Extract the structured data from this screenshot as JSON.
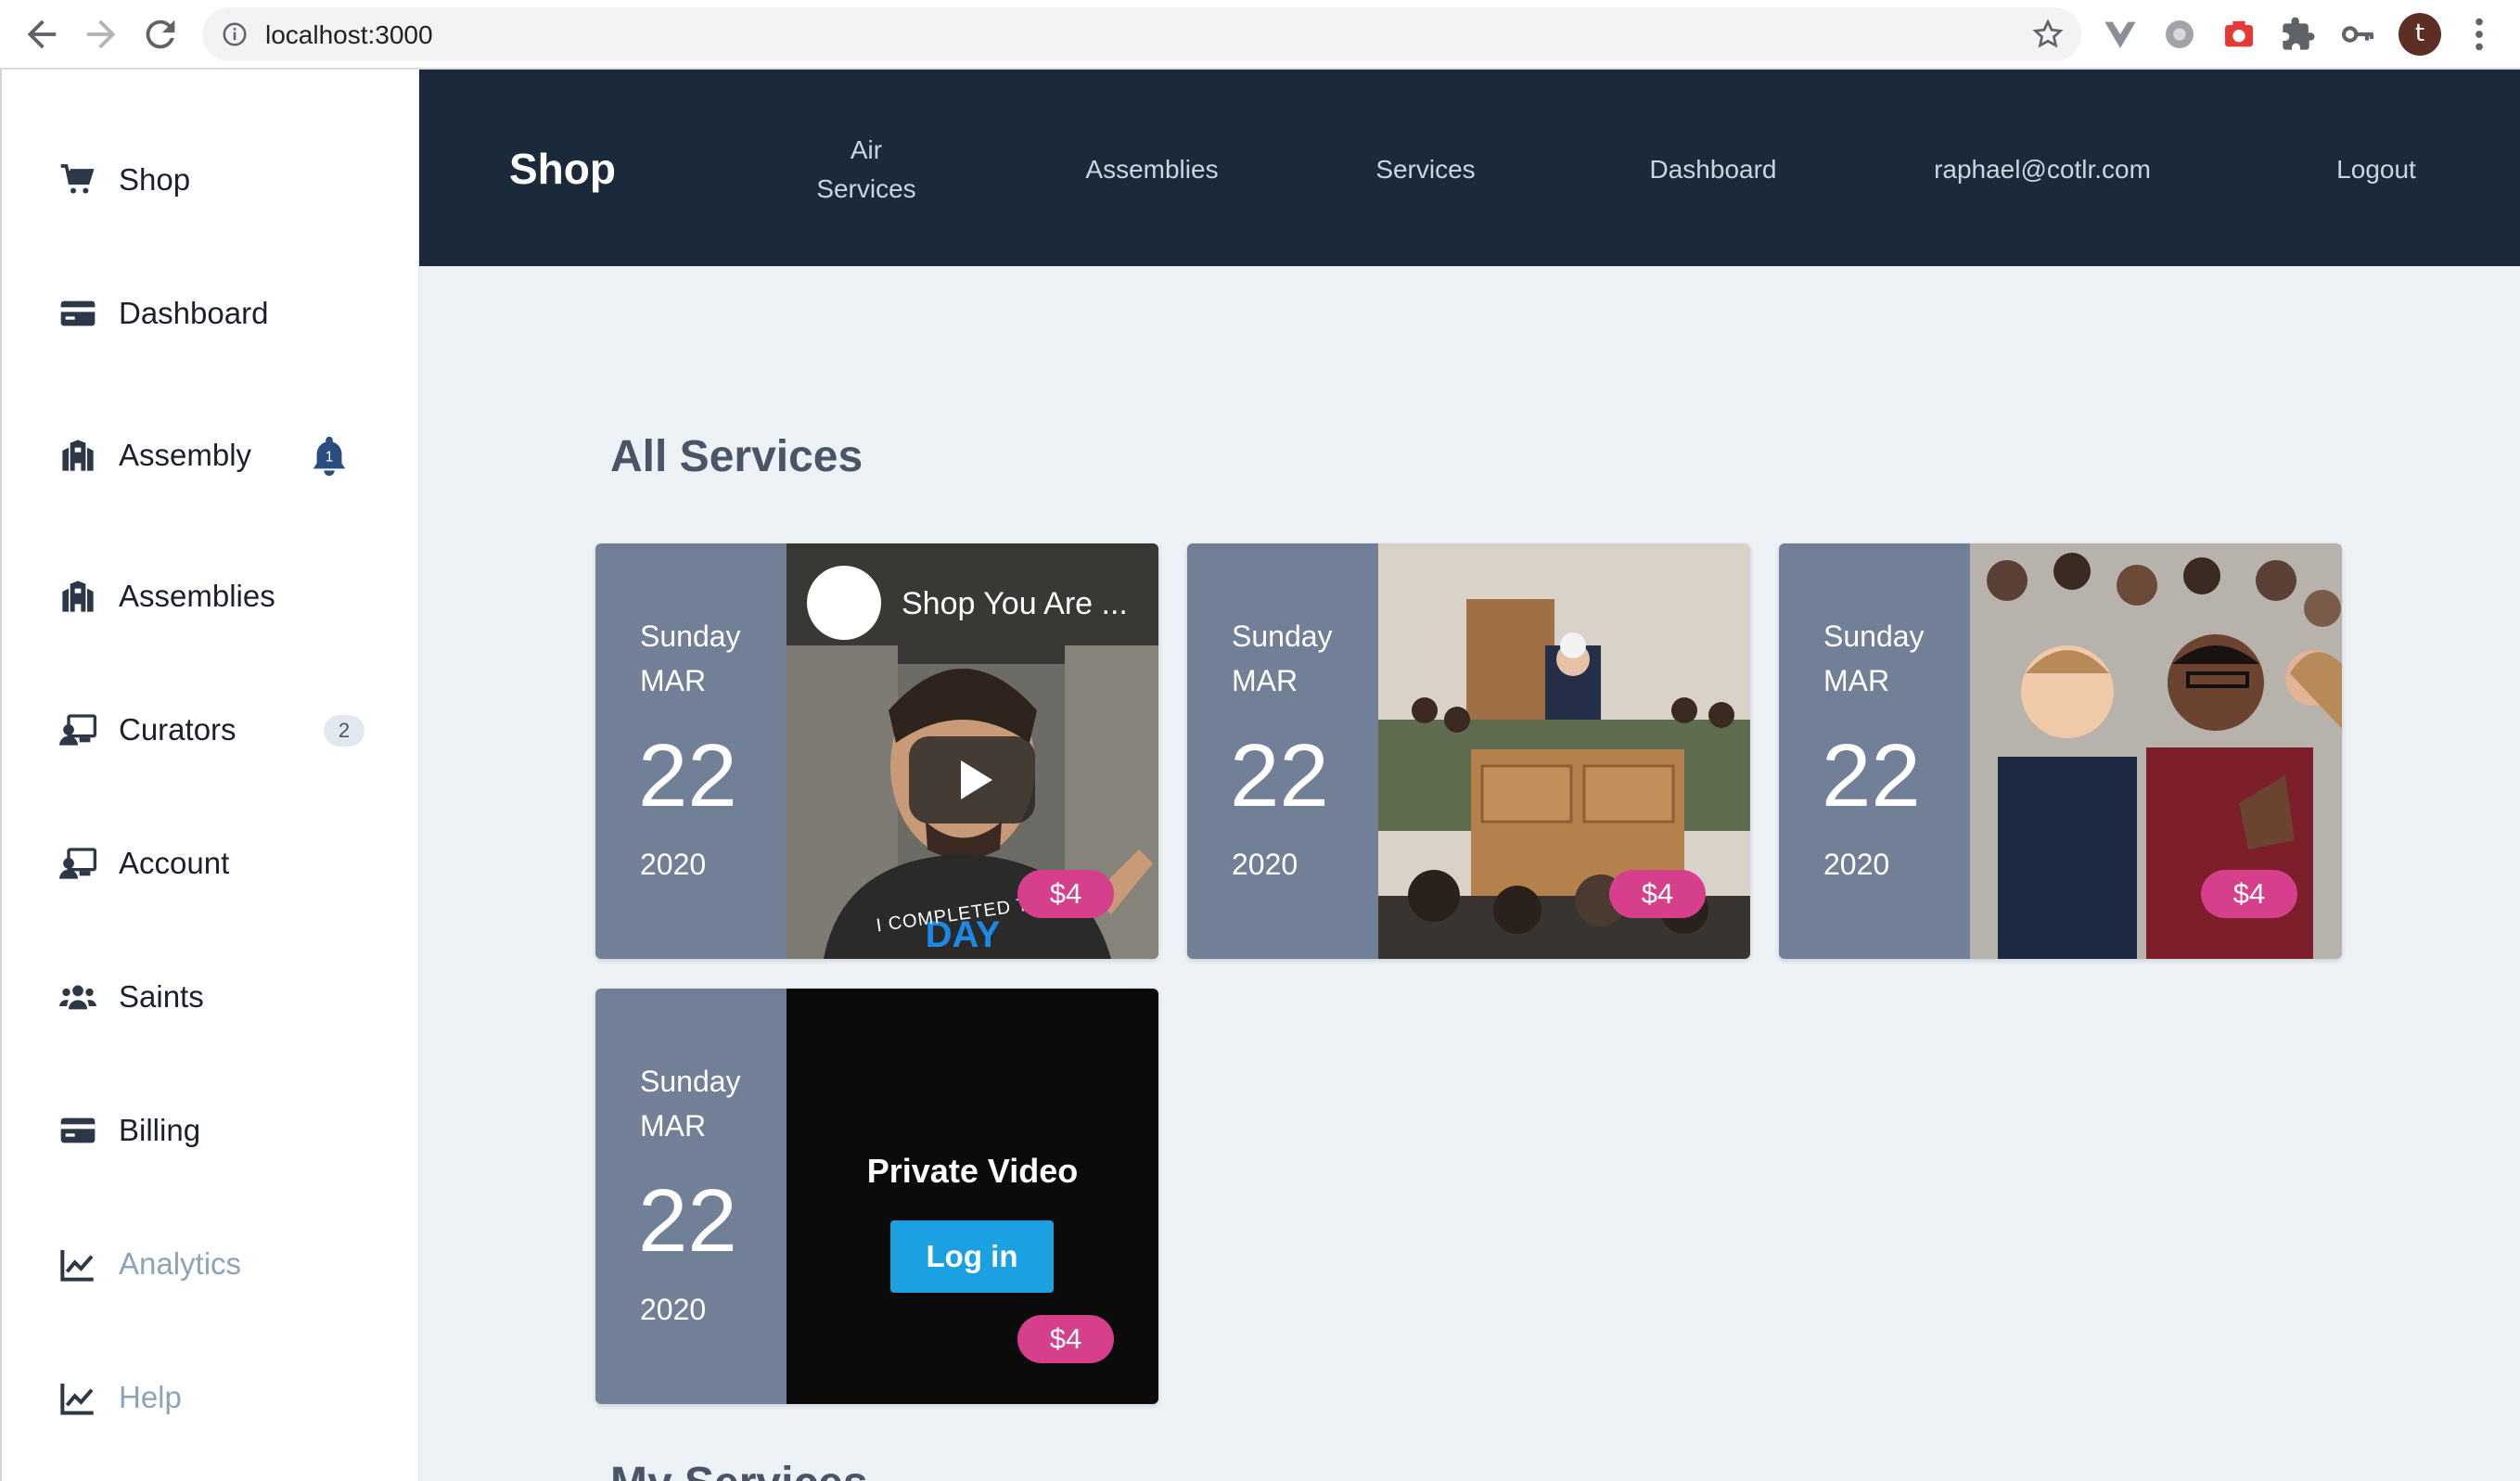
{
  "browser": {
    "url": "localhost:3000",
    "avatar_letter": "t",
    "extension_icons": [
      "vue-devtools-icon",
      "settings-extension-icon",
      "camera-icon",
      "puzzle-icon",
      "key-icon"
    ]
  },
  "sidebar": {
    "items": [
      {
        "label": "Shop",
        "icon": "cart-icon"
      },
      {
        "label": "Dashboard",
        "icon": "card-icon"
      },
      {
        "label": "Assembly",
        "icon": "building-icon",
        "notification": "1"
      },
      {
        "label": "Assemblies",
        "icon": "building-icon"
      },
      {
        "label": "Curators",
        "icon": "curator-icon",
        "count": "2"
      },
      {
        "label": "Account",
        "icon": "curator-icon"
      },
      {
        "label": "Saints",
        "icon": "users-icon"
      },
      {
        "label": "Billing",
        "icon": "card-icon"
      },
      {
        "label": "Analytics",
        "icon": "chart-icon"
      },
      {
        "label": "Help",
        "icon": "chart-icon"
      }
    ]
  },
  "header": {
    "brand": "Shop",
    "links": [
      "Air",
      "Services",
      "Assemblies",
      "Services",
      "Dashboard",
      "raphael@cotlr.com",
      "Logout"
    ]
  },
  "main": {
    "section_title": "All Services",
    "next_section_title": "My Services",
    "cards": [
      {
        "weekday": "Sunday",
        "month": "MAR",
        "day": "22",
        "year": "2020",
        "price": "$4",
        "video_title": "Shop You Are ...",
        "shirt_text": "I COMPLETED THE"
      },
      {
        "weekday": "Sunday",
        "month": "MAR",
        "day": "22",
        "year": "2020",
        "price": "$4"
      },
      {
        "weekday": "Sunday",
        "month": "MAR",
        "day": "22",
        "year": "2020",
        "price": "$4"
      },
      {
        "weekday": "Sunday",
        "month": "MAR",
        "day": "22",
        "year": "2020",
        "price": "$4",
        "private_title": "Private Video",
        "login_label": "Log in"
      }
    ]
  },
  "colors": {
    "header_bg": "#1a2a3a",
    "date_panel": "#718096",
    "price_badge": "#d53f8c",
    "login_button": "#1ba1e2",
    "main_bg": "#edf2f7"
  }
}
